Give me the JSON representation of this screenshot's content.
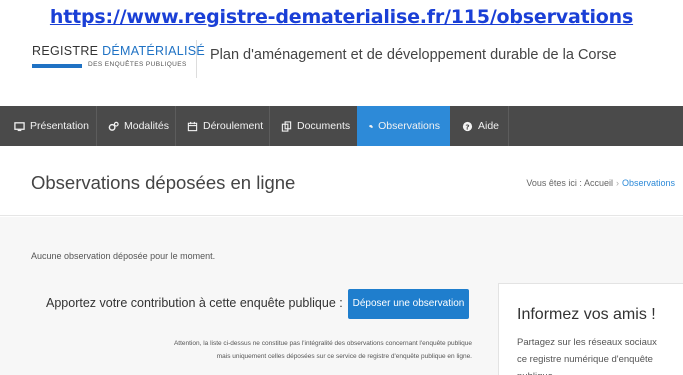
{
  "banner": {
    "url": "https://www.registre-dematerialise.fr/115/observations"
  },
  "header": {
    "logo_line1_a": "REGISTRE ",
    "logo_line1_b": "DÉMATÉRIALISÉ",
    "logo_line2": "DES ENQUÊTES PUBLIQUES",
    "site_title": "Plan d'aménagement et de développement durable de la Corse"
  },
  "nav": {
    "items": [
      {
        "label": "Présentation",
        "icon": "monitor-icon"
      },
      {
        "label": "Modalités",
        "icon": "gears-icon"
      },
      {
        "label": "Déroulement",
        "icon": "calendar-icon"
      },
      {
        "label": "Documents",
        "icon": "copy-icon"
      },
      {
        "label": "Observations",
        "icon": "comments-icon",
        "active": true
      },
      {
        "label": "Aide",
        "icon": "question-circle-icon"
      }
    ]
  },
  "title_band": {
    "title": "Observations déposées en ligne",
    "breadcrumb_prefix": "Vous êtes ici :",
    "breadcrumb_home": "Accueil",
    "breadcrumb_current": "Observations"
  },
  "main": {
    "none_message": "Aucune observation déposée pour le moment.",
    "cta_label": "Apportez votre contribution à cette enquête publique :",
    "cta_button": "Déposer une observation",
    "note_line1": "Attention, la liste ci-dessus ne constitue pas l'intégralité des observations concernant l'enquête publique",
    "note_line2": "mais uniquement celles déposées sur ce service de registre d'enquête publique en ligne."
  },
  "share": {
    "title": "Informez vos amis !",
    "text": "Partagez sur les réseaux sociaux ce registre numérique d'enquête publique."
  },
  "colors": {
    "accent": "#1f72c4",
    "nav_bg": "#4a4a4a",
    "nav_active": "#2d8ad8",
    "button": "#1f7ecd",
    "banner_link": "#1a3fd6"
  }
}
